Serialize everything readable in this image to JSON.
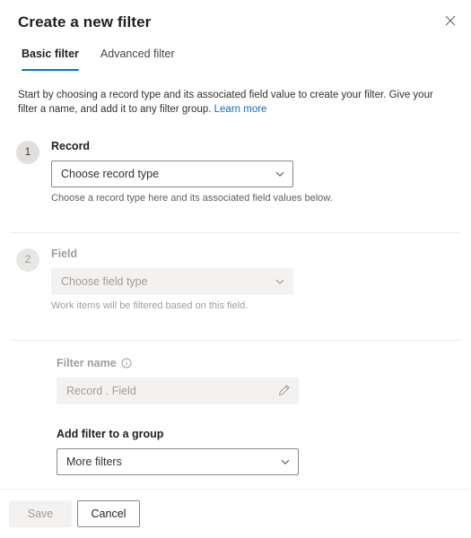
{
  "panel": {
    "title": "Create a new filter",
    "close_label": "Close"
  },
  "tabs": [
    {
      "label": "Basic filter",
      "active": true
    },
    {
      "label": "Advanced filter",
      "active": false
    }
  ],
  "intro": {
    "text": "Start by choosing a record type and its associated field value to create your filter. Give your filter a name, and add it to any filter group.",
    "link_label": "Learn more"
  },
  "steps": [
    {
      "number": "1",
      "label": "Record",
      "dropdown_value": "Choose record type",
      "note": "Choose a record type here and its associated field values below.",
      "disabled": false
    },
    {
      "number": "2",
      "label": "Field",
      "dropdown_value": "Choose field type",
      "note": "Work items will be filtered based on this field.",
      "disabled": true
    }
  ],
  "filter_name": {
    "label": "Filter name",
    "info_icon": "info-circle-icon",
    "value": "Record . Field",
    "edit_icon": "pencil-icon"
  },
  "filter_group": {
    "label": "Add filter to a group",
    "dropdown_value": "More filters"
  },
  "footer": {
    "save_label": "Save",
    "cancel_label": "Cancel"
  },
  "colors": {
    "accent": "#0078d4",
    "link": "#0f6cbd",
    "divider": "#edebe9",
    "disabled_bg": "#f3f2f1",
    "disabled_text": "#a19f9d"
  }
}
